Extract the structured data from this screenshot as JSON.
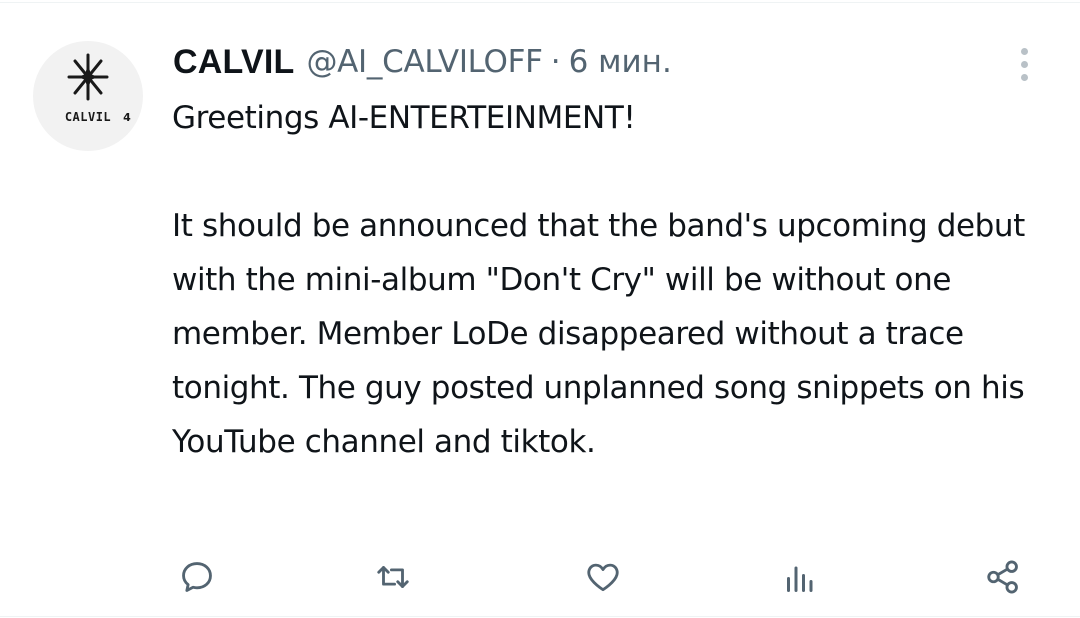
{
  "tweet": {
    "author": {
      "display_name": "CALVIL",
      "handle": "@AI_CALVILOFF",
      "avatar_logo_text": "CALVIL4"
    },
    "separator": "·",
    "timestamp": "6 мин.",
    "text": "Greetings AI-ENTERTEINMENT!\n\nIt should be announced that the band's upcoming debut with the mini-album \"Don't Cry\" will be without one member. Member LoDe disappeared without a trace tonight. The guy posted unplanned song snippets on his YouTube channel and tiktok.",
    "actions": [
      {
        "name": "reply",
        "icon": "speech-bubble-icon"
      },
      {
        "name": "retweet",
        "icon": "retweet-icon"
      },
      {
        "name": "like",
        "icon": "heart-icon"
      },
      {
        "name": "views",
        "icon": "bar-chart-icon"
      },
      {
        "name": "share",
        "icon": "share-nodes-icon"
      }
    ]
  },
  "colors": {
    "text_primary": "#0f1419",
    "text_secondary": "#536471",
    "icon": "#536471",
    "avatar_bg": "#f2f2f2"
  }
}
